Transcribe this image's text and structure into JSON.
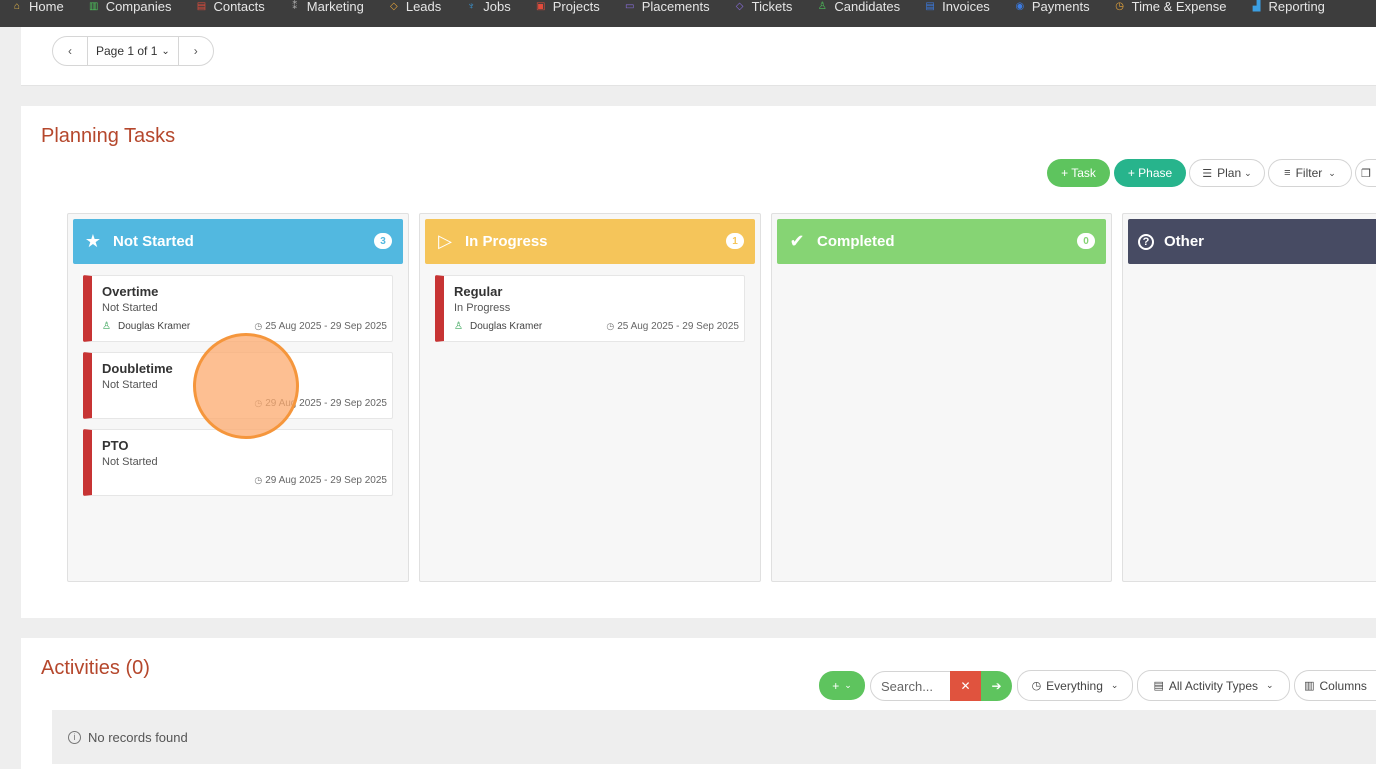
{
  "nav": {
    "items": [
      {
        "label": "Home",
        "icon": "home-icon",
        "color": "#e6b84a",
        "glyph": "⌂"
      },
      {
        "label": "Companies",
        "icon": "building-icon",
        "color": "#4cc25a",
        "glyph": "▥"
      },
      {
        "label": "Contacts",
        "icon": "contact-book-icon",
        "color": "#e24b3b",
        "glyph": "▤"
      },
      {
        "label": "Marketing",
        "icon": "broadcast-icon",
        "color": "#b0b0b0",
        "glyph": "⁑"
      },
      {
        "label": "Leads",
        "icon": "diamond-icon",
        "color": "#e8a53a",
        "glyph": "◇"
      },
      {
        "label": "Jobs",
        "icon": "trophy-icon",
        "color": "#3b9fe2",
        "glyph": "♆"
      },
      {
        "label": "Projects",
        "icon": "clipboard-icon",
        "color": "#e24b3b",
        "glyph": "▣"
      },
      {
        "label": "Placements",
        "icon": "briefcase-icon",
        "color": "#8b6fe0",
        "glyph": "▭"
      },
      {
        "label": "Tickets",
        "icon": "tag-icon",
        "color": "#8b6fe0",
        "glyph": "◇"
      },
      {
        "label": "Candidates",
        "icon": "user-icon",
        "color": "#4cc25a",
        "glyph": "♙"
      },
      {
        "label": "Invoices",
        "icon": "invoice-icon",
        "color": "#3b7be2",
        "glyph": "▤"
      },
      {
        "label": "Payments",
        "icon": "coins-icon",
        "color": "#3b7be2",
        "glyph": "◉"
      },
      {
        "label": "Time & Expense",
        "icon": "clock-icon",
        "color": "#e8a53a",
        "glyph": "◷"
      },
      {
        "label": "Reporting",
        "icon": "bar-chart-icon",
        "color": "#3b9fe2",
        "glyph": "▟"
      }
    ]
  },
  "pager": {
    "label": "Page 1 of 1",
    "prev": "‹",
    "next": "›",
    "caret": "⌄"
  },
  "planning": {
    "title": "Planning Tasks",
    "toolbar": {
      "task": "+ Task",
      "phase": "+ Phase",
      "plan": "Plan",
      "filter": "Filter"
    },
    "columns": [
      {
        "name": "Not Started",
        "count": "3",
        "color": "#52b8e0",
        "icon": "star-icon",
        "glyph": "★"
      },
      {
        "name": "In Progress",
        "count": "1",
        "color": "#f5c55a",
        "icon": "play-icon",
        "glyph": "▷"
      },
      {
        "name": "Completed",
        "count": "0",
        "color": "#86d474",
        "icon": "check-icon",
        "glyph": "✔"
      },
      {
        "name": "Other",
        "count": "",
        "color": "#474b63",
        "icon": "question-icon",
        "glyph": "?"
      }
    ],
    "cards": {
      "not_started": [
        {
          "title": "Overtime",
          "status": "Not Started",
          "user": "Douglas Kramer",
          "dates": "25 Aug 2025 - 29 Sep 2025"
        },
        {
          "title": "Doubletime",
          "status": "Not Started",
          "user": "",
          "dates": "29 Aug 2025 - 29 Sep 2025"
        },
        {
          "title": "PTO",
          "status": "Not Started",
          "user": "",
          "dates": "29 Aug 2025 - 29 Sep 2025"
        }
      ],
      "in_progress": [
        {
          "title": "Regular",
          "status": "In Progress",
          "user": "Douglas Kramer",
          "dates": "25 Aug 2025 - 29 Sep 2025"
        }
      ]
    }
  },
  "activities": {
    "title": "Activities (0)",
    "add": "+",
    "search_placeholder": "Search...",
    "clear": "✕",
    "go": "➔",
    "everything": "Everything",
    "activity_types": "All Activity Types",
    "columns": "Columns",
    "no_records": "No records found"
  }
}
